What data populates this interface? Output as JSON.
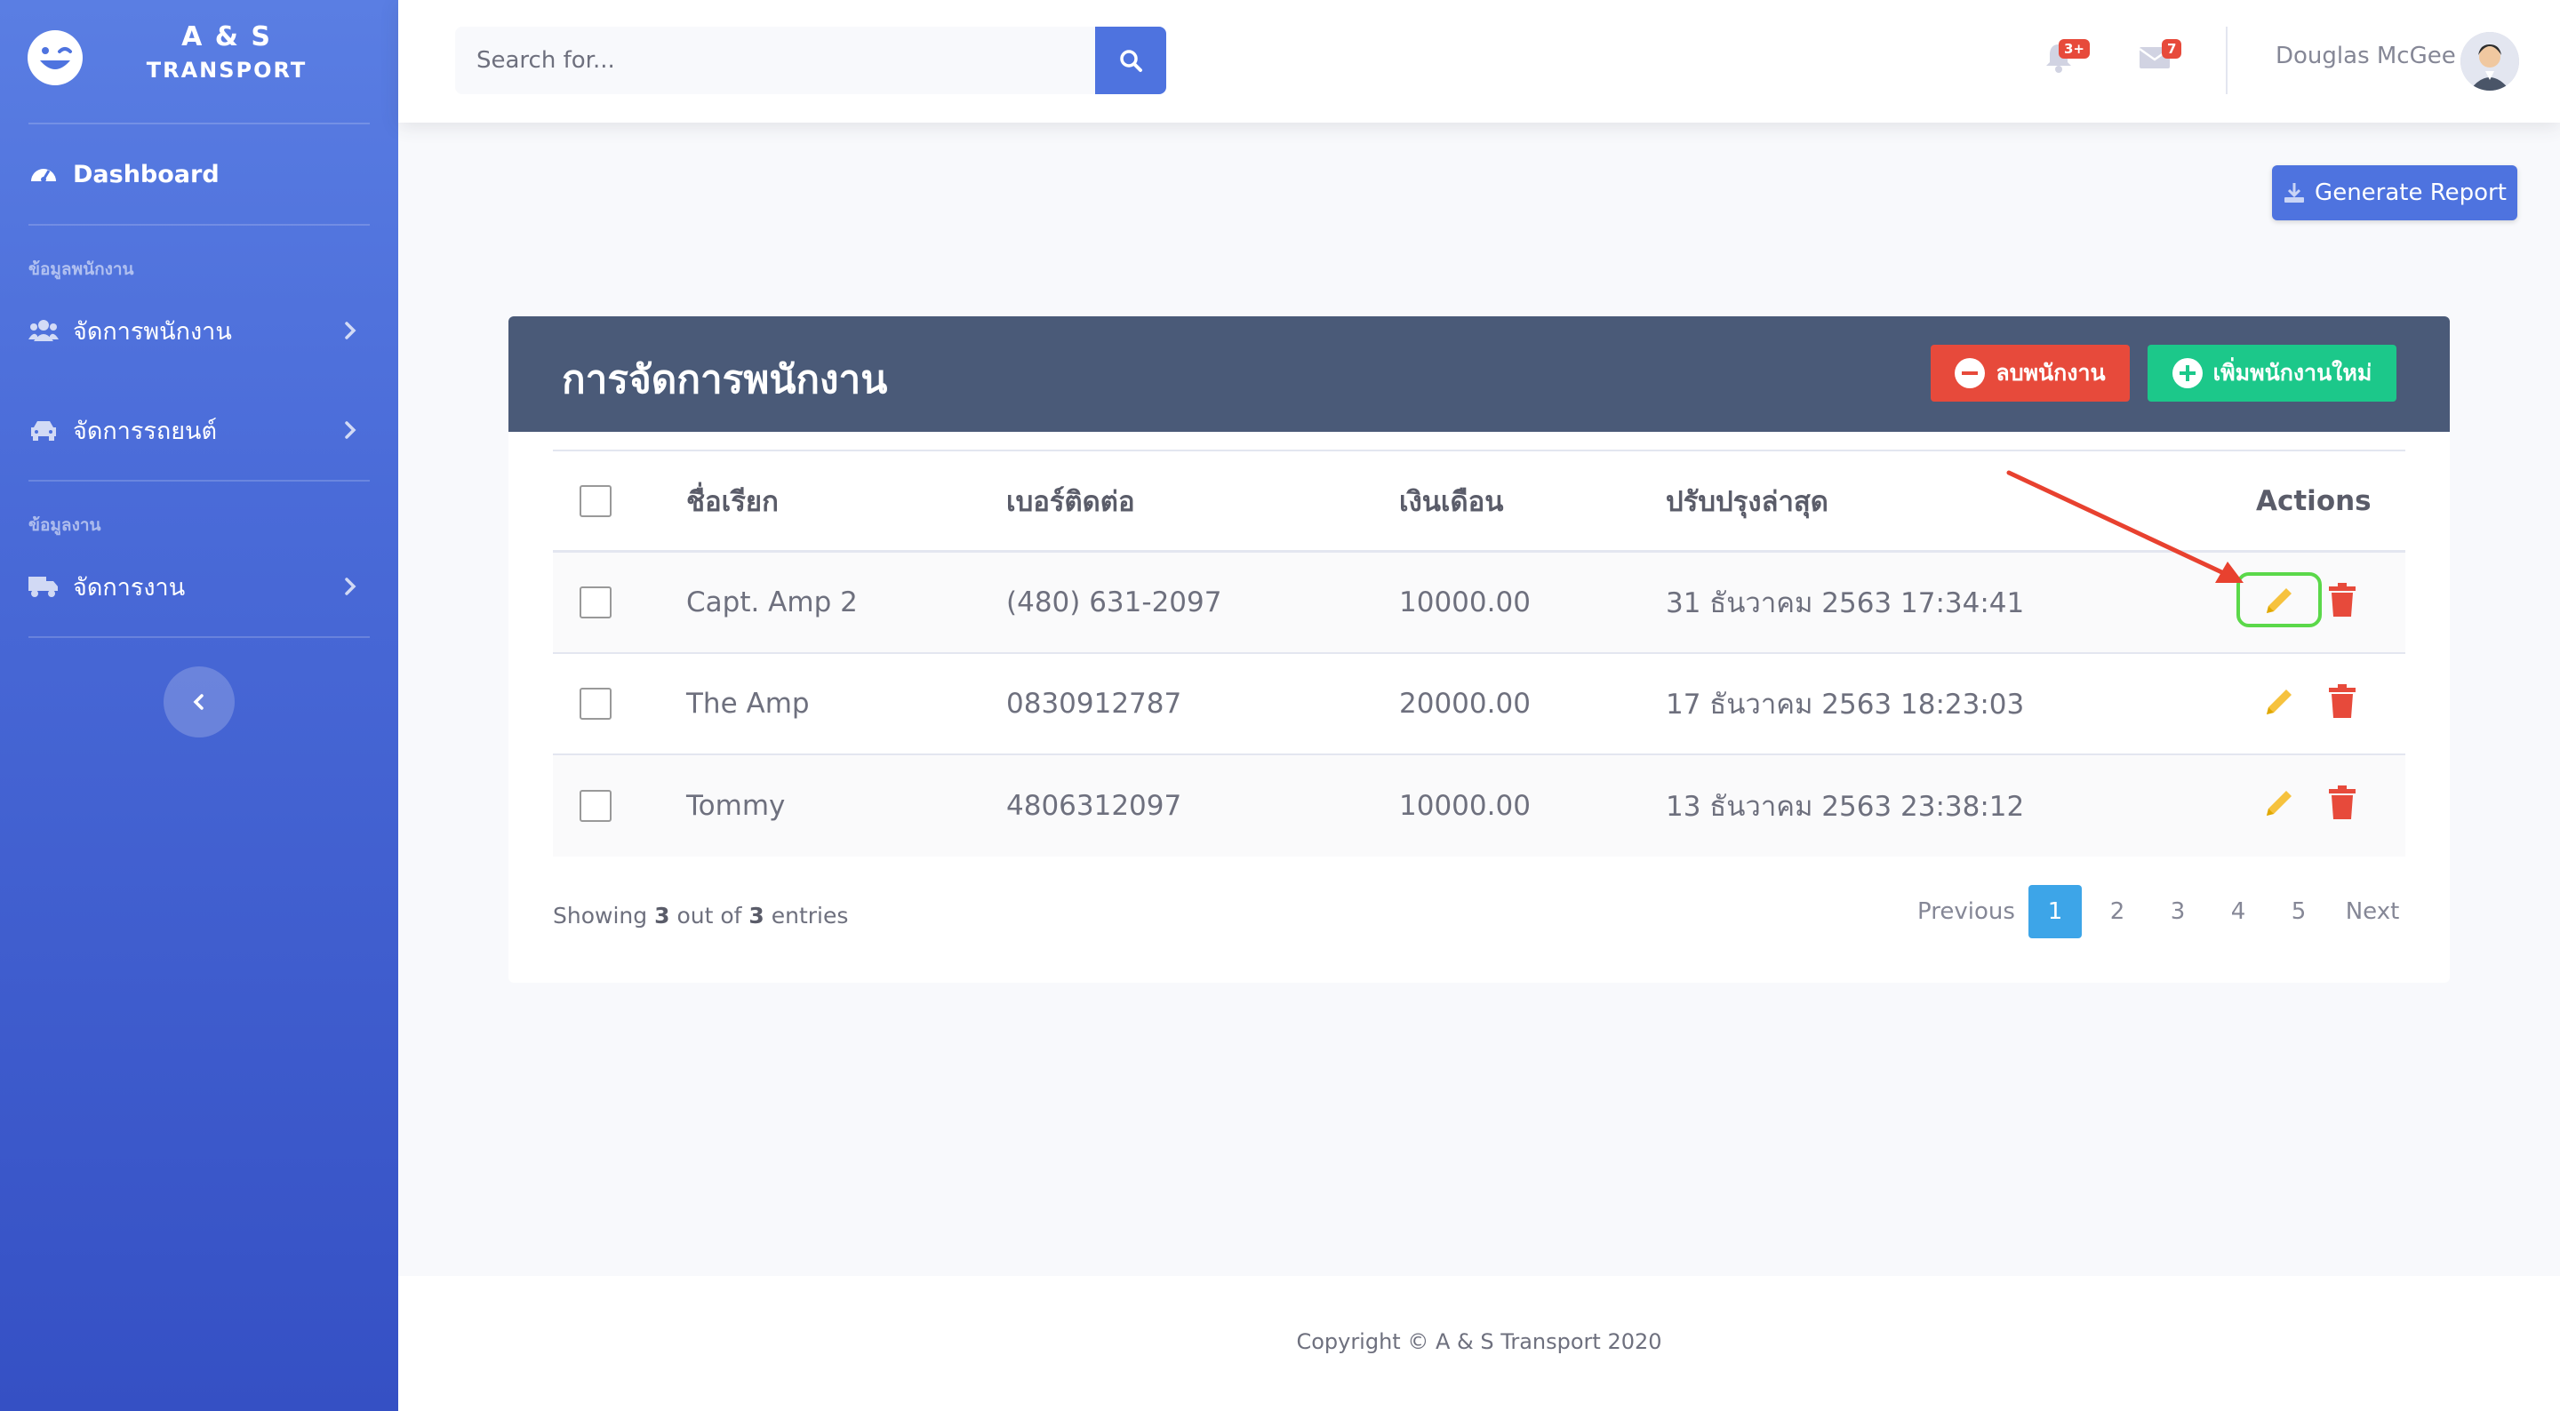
{
  "brand": {
    "line1": "A & S",
    "line2": "TRANSPORT"
  },
  "sidebar": {
    "dashboard": "Dashboard",
    "heading_employee": "ข้อมูลพนักงาน",
    "manage_employee": "จัดการพนักงาน",
    "manage_car": "จัดการรถยนต์",
    "heading_job": "ข้อมูลงาน",
    "manage_job": "จัดการงาน"
  },
  "search": {
    "placeholder": "Search for..."
  },
  "alerts": {
    "badge": "3+"
  },
  "messages": {
    "badge": "7"
  },
  "user": {
    "name": "Douglas McGee"
  },
  "generate_report": "Generate Report",
  "card": {
    "title": "การจัดการพนักงาน",
    "delete_btn": "ลบพนักงาน",
    "add_btn": "เพิ่มพนักงานใหม่"
  },
  "table": {
    "headers": {
      "name": "ชื่อเรียก",
      "phone": "เบอร์ติดต่อ",
      "salary": "เงินเดือน",
      "updated": "ปรับปรุงล่าสุด",
      "actions": "Actions"
    },
    "rows": [
      {
        "name": "Capt. Amp 2",
        "phone": "(480) 631-2097",
        "salary": "10000.00",
        "updated": "31 ธันวาคม 2563 17:34:41"
      },
      {
        "name": "The Amp",
        "phone": "0830912787",
        "salary": "20000.00",
        "updated": "17 ธันวาคม 2563 18:23:03"
      },
      {
        "name": "Tommy",
        "phone": "4806312097",
        "salary": "10000.00",
        "updated": "13 ธันวาคม 2563 23:38:12"
      }
    ]
  },
  "showing": {
    "prefix": "Showing",
    "count": "3",
    "mid": "out of",
    "total": "3",
    "suffix": "entries"
  },
  "pagination": {
    "previous": "Previous",
    "pages": [
      "1",
      "2",
      "3",
      "4",
      "5"
    ],
    "next": "Next",
    "active": "1"
  },
  "footer": {
    "copyright": "Copyright © A & S Transport 2020"
  },
  "colors": {
    "primary": "#4e73df",
    "danger": "#e74a3b",
    "success": "#1cc88a",
    "warning": "#f6c23e",
    "card_header": "#4a5a78",
    "highlight": "#5bd84a"
  }
}
